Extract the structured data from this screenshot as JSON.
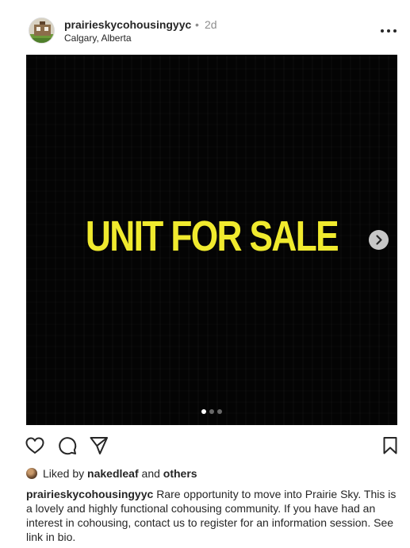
{
  "post": {
    "username": "prairieskycohousingyyc",
    "separator": "•",
    "time": "2d",
    "location": "Calgary, Alberta"
  },
  "media": {
    "text": "UNIT FOR SALE",
    "slide_count": 3,
    "active_slide": 1
  },
  "icons": {
    "more": "more-options-icon",
    "like": "heart-icon",
    "comment": "comment-icon",
    "share": "paper-plane-icon",
    "save": "bookmark-icon",
    "next": "chevron-right-icon"
  },
  "likes": {
    "prefix": "Liked by",
    "user": "nakedleaf",
    "middle": "and",
    "others": "others"
  },
  "caption": {
    "username": "prairieskycohousingyyc",
    "text": "Rare opportunity to move into Prairie Sky. This is a lovely and highly functional cohousing community. If you have had an interest in cohousing, contact us to register for an information session. See link in bio."
  },
  "colors": {
    "media_background": "#040404",
    "headline": "#f0ea2e",
    "text": "#262626",
    "muted": "#8e8e8e"
  }
}
